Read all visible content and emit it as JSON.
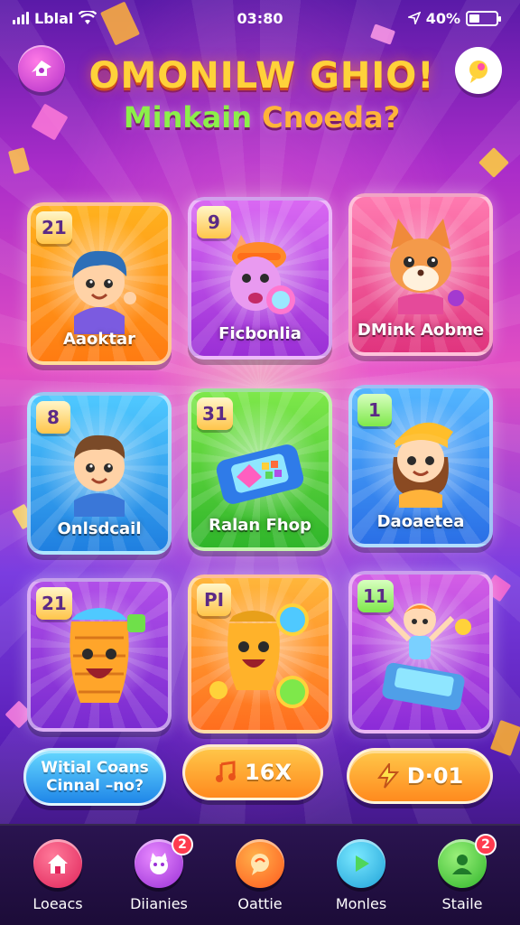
{
  "status_bar": {
    "carrier": "Lblal",
    "time": "03:80",
    "battery_percent": "40%",
    "battery_level": 0.4
  },
  "header": {
    "title_line1": "OMONILW GHIO!",
    "title_line2_a": "Minkain ",
    "title_line2_b": "Cnoeda?"
  },
  "cards": [
    {
      "badge": "21",
      "label": "Aaoktar",
      "color_top": "#ffb21e",
      "color_bottom": "#ff7b12"
    },
    {
      "badge": "9",
      "label": "Ficbonlia",
      "color_top": "#d968f2",
      "color_bottom": "#9a2fd6"
    },
    {
      "badge": "",
      "label": "DMink Aobme",
      "color_top": "#ff7ab0",
      "color_bottom": "#e0347e"
    },
    {
      "badge": "8",
      "label": "Onlsdcail",
      "color_top": "#4fc9ff",
      "color_bottom": "#1f7fe0"
    },
    {
      "badge": "31",
      "label": "Ralan Fhop",
      "color_top": "#7ee84a",
      "color_bottom": "#2fb52a"
    },
    {
      "badge": "1",
      "label": "Daoaetea",
      "color_top": "#53b6ff",
      "color_bottom": "#2a6fe6"
    },
    {
      "badge": "21",
      "label": "",
      "color_top": "#b04ee8",
      "color_bottom": "#7a2bd0"
    },
    {
      "badge": "PI",
      "label": "",
      "color_top": "#ffb63a",
      "color_bottom": "#ff6e1e"
    },
    {
      "badge": "11",
      "label": "",
      "color_top": "#d45ee6",
      "color_bottom": "#8b2bd8"
    }
  ],
  "actions": {
    "left_line1": "Witial Coans",
    "left_line2": "Cinnal –no?",
    "middle": "16X",
    "right": "D·01"
  },
  "nav": [
    {
      "label": "Loeacs",
      "icon": "home-icon",
      "badge": ""
    },
    {
      "label": "Diianies",
      "icon": "pet-icon",
      "badge": "2"
    },
    {
      "label": "Oattie",
      "icon": "chat-icon",
      "badge": ""
    },
    {
      "label": "Monles",
      "icon": "play-icon",
      "badge": ""
    },
    {
      "label": "Staile",
      "icon": "person-icon",
      "badge": "2"
    }
  ]
}
